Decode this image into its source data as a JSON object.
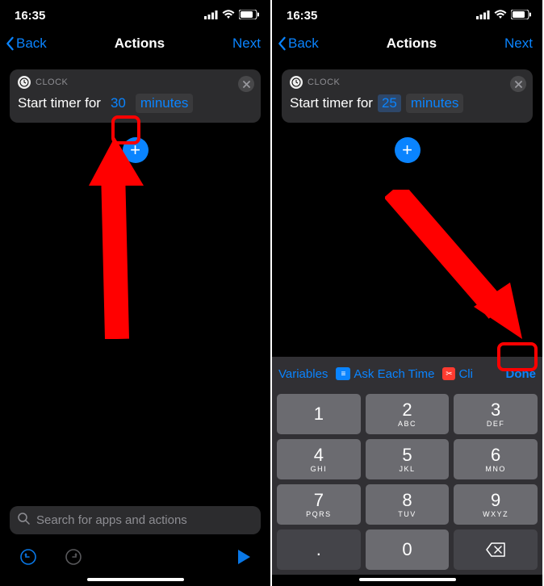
{
  "colors": {
    "accent": "#0a84ff",
    "annotation": "#ff0000"
  },
  "left": {
    "status": {
      "time": "16:35"
    },
    "nav": {
      "back": "Back",
      "title": "Actions",
      "next": "Next"
    },
    "card": {
      "app": "CLOCK",
      "prefix": "Start timer for",
      "value": "30",
      "unit": "minutes"
    },
    "search_placeholder": "Search for apps and actions"
  },
  "right": {
    "status": {
      "time": "16:35"
    },
    "nav": {
      "back": "Back",
      "title": "Actions",
      "next": "Next"
    },
    "card": {
      "app": "CLOCK",
      "prefix": "Start timer for",
      "value": "25",
      "unit": "minutes"
    },
    "accessory": {
      "variables": "Variables",
      "ask": "Ask Each Time",
      "clipboard_partial": "Cli",
      "done": "Done"
    },
    "keypad": [
      {
        "digit": "1",
        "sub": ""
      },
      {
        "digit": "2",
        "sub": "ABC"
      },
      {
        "digit": "3",
        "sub": "DEF"
      },
      {
        "digit": "4",
        "sub": "GHI"
      },
      {
        "digit": "5",
        "sub": "JKL"
      },
      {
        "digit": "6",
        "sub": "MNO"
      },
      {
        "digit": "7",
        "sub": "PQRS"
      },
      {
        "digit": "8",
        "sub": "TUV"
      },
      {
        "digit": "9",
        "sub": "WXYZ"
      },
      {
        "digit": ".",
        "sub": "",
        "func": true
      },
      {
        "digit": "0",
        "sub": ""
      },
      {
        "digit": "⌫",
        "sub": "",
        "func": true
      }
    ]
  }
}
